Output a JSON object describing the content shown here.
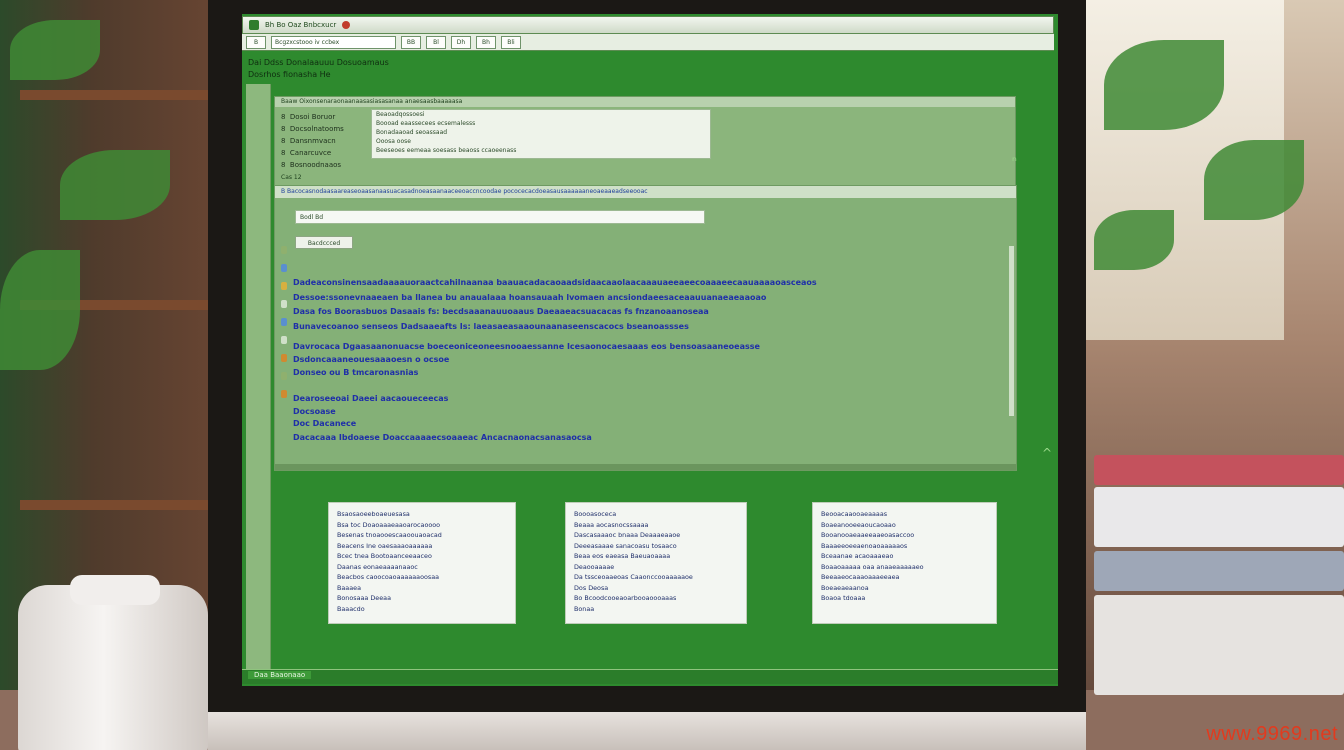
{
  "window": {
    "title": "Bh  Bo  Oaz  Bnbcxucr"
  },
  "toolbar": {
    "address": "Bcgzxcstooo iv ccbex",
    "buttons": [
      "B",
      "BB",
      "Bl",
      "Dh",
      "Bh",
      "Bli"
    ]
  },
  "menu": {
    "line1": "Dai  Ddss Donalaauuu Dosuoamaus",
    "line2": "Dosrhos fionasha  He"
  },
  "panel1": {
    "header": "Baaw Oixonsenaraonaanaasasiasasanaa anaesaasbaaaaasa",
    "rows": [
      {
        "num": "8",
        "label": "Dosoi  Boruor"
      },
      {
        "num": "8",
        "label": "Docsolnatooms"
      },
      {
        "num": "8",
        "label": "Dansnmvacn"
      },
      {
        "num": "8",
        "label": "Canarcuvce"
      },
      {
        "num": "8",
        "label": "Bosnoodnaaos"
      }
    ],
    "list_items": [
      "Beaoadqossoesi",
      "Boooad eaassecees ecsemalesss",
      "Bonadaaoad seoassaad",
      "Ooosa  oose",
      "Beeseoes eemeaa soesass beaoss ccaoeenass"
    ],
    "status": "Cas 12"
  },
  "panel2": {
    "header": "B  Bacocasnodaasaareaseoaasanaasuacasadnoeasaanaaceeoaccncoodae  pococecacdoeasausaaaaaaneoaeaaeadseeooac",
    "input_value": "Bodl  Bd",
    "button_label": "Bacdccced",
    "lines": [
      "Dadeaconsinensaadaaaauoraactcahilnaanaa baauacadacaoaadsidaacaaolaacaaauaeeaeecoaaaeecaauaaaaoasceaos",
      "Dessoe:ssonevnaaeaen ba llanea bu  anaualaaa  hoansauaah  lvomaen ancsiondaeesaceaauuanaeaeaaoao",
      "Dasa fos Boorasbuos Dasaais  fs:  becdsaaanauuoaaus   Daeaaeacsuacacas  fs fnzanoaanoseaa",
      "Bunavecoanoo senseos Dadsaaeafts Is:   laeasaeasaaounaanaseenscacocs  bseanoassses",
      "Davrocaca  Dgaasaanonuacse  boeceoniceoneesnooaessanne  Icesaonocaesaaas eos  bensoasaaneoeasse",
      "Dsdoncaaaneouesaaaoesn             o ocsoe",
      "Donseo ou B  tmcaronasnias",
      "Dearoseeoai  Daeei aacaoueceecas",
      "Docsoase",
      "Doc Dacanece",
      "Dacacaaa Ibdoaese  Doaccaaaaecsoaaeac  Ancacnaonacsanasaocsa"
    ]
  },
  "boxes": [
    {
      "lines": [
        "Bsaosaoeeboaeuesasa",
        "Bsa  toc  Doaoaaaeaaoarocaoooo",
        "Besenas  tnoaooescaaoouaoacad",
        "Beacens  Ine  oaesaaaoaaaaaa",
        "Bcec   tnea  Bootoaanceeaaceo",
        "Daanas eonaeaaaanaaoc",
        "Beacbos caoocoaoaaaaaaoosaa",
        "Baaaea",
        "Bonosaaa Deeaa",
        "Baaacdo"
      ]
    },
    {
      "lines": [
        "Boooasoceca",
        "Beaaa  aocasnocssaaaa",
        "Dascasaaaoc  bnaaa  Deaaaeaaoe",
        "Deeeasaaae  sanacoasu  tosaaco",
        "Beaa eos eaeasa Baeuaoaaaa",
        "Deaooaaaae",
        "Da  tssceoaaeoas  Caaonccooaaaaaoe",
        "Dos  Deosa",
        "Bo  Bcoodcooeaoarbooaoooaaas",
        "Bonaa"
      ]
    },
    {
      "lines": [
        "Beooacaaooaeaaaas",
        "Boaeanooeeaoucaoaao",
        "Booanooaeaaeeaaeoasaccoo",
        "Baaaeeoeeaenoaoaaaaaos",
        "Bceaanae  acaoaaaeao",
        "Boaaoaaaaa  oaa  anaaeaaaaaeo",
        "Beeaaeocaaaoaaaeeaea",
        "Boeaeaeaanoa",
        "Boaoa  tdoaaa"
      ]
    }
  ],
  "status_bar": {
    "text": "Daa  Baaonaao"
  },
  "watermark": "www.9969.net",
  "colors": {
    "desktop_green": "#2e8a2e",
    "panel_green": "#84b077",
    "link_blue": "#1f2fa8",
    "watermark_red": "#e23a1e"
  }
}
